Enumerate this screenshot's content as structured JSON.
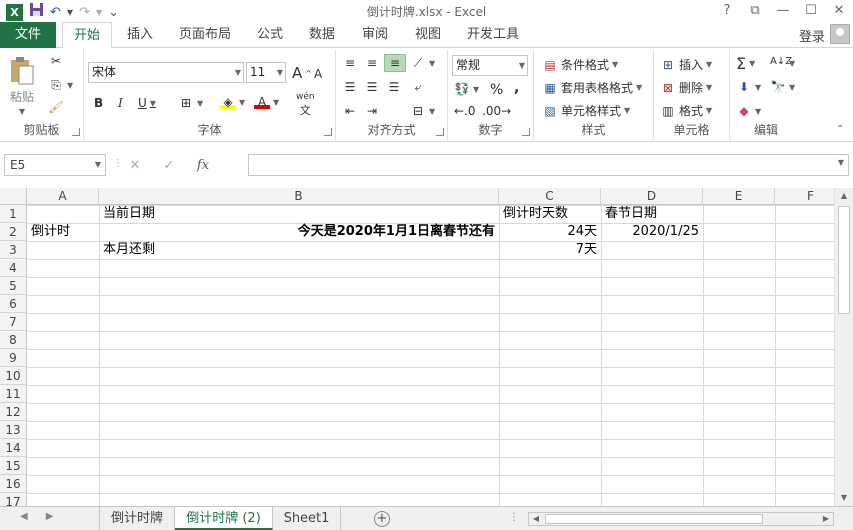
{
  "window": {
    "title": "倒计时牌.xlsx - Excel",
    "help": "?",
    "controls": [
      "⧉",
      "—",
      "☐",
      "✕"
    ]
  },
  "qat": {
    "logo": "X",
    "save": "💾",
    "undo": "↶",
    "redo": "↷",
    "customize": "⌄"
  },
  "tabs": {
    "file": "文件",
    "items": [
      "开始",
      "插入",
      "页面布局",
      "公式",
      "数据",
      "审阅",
      "视图",
      "开发工具"
    ],
    "active": "开始",
    "login": "登录"
  },
  "ribbon": {
    "clipboard": {
      "label": "剪贴板",
      "paste": "粘贴"
    },
    "font": {
      "label": "字体",
      "name": "宋体",
      "size": "11",
      "bold": "B",
      "italic": "I",
      "underline": "U",
      "grow": "A",
      "shrink": "A",
      "wen": "wén"
    },
    "alignment": {
      "label": "对齐方式"
    },
    "number": {
      "label": "数字",
      "format": "常规",
      "percent": "%",
      "comma": ","
    },
    "styles": {
      "label": "样式",
      "conditional": "条件格式",
      "table": "套用表格格式",
      "cell_styles": "单元格样式"
    },
    "cells": {
      "label": "单元格",
      "insert": "插入",
      "delete": "删除",
      "format": "格式"
    },
    "editing": {
      "label": "编辑"
    }
  },
  "formula_bar": {
    "name_box": "E5",
    "cancel": "✕",
    "enter": "✓",
    "fx": "fx",
    "value": ""
  },
  "grid": {
    "columns": [
      "A",
      "B",
      "C",
      "D",
      "E",
      "F"
    ],
    "rows": [
      "1",
      "2",
      "3",
      "4",
      "5",
      "6",
      "7",
      "8",
      "9",
      "10",
      "11",
      "12",
      "13",
      "14",
      "15",
      "16",
      "17"
    ],
    "cells": {
      "B1": "当前日期",
      "C1": "倒计时天数",
      "D1": "春节日期",
      "A2": "倒计时",
      "B2": "今天是2020年1月1日离春节还有",
      "C2": "24天",
      "D2": "2020/1/25",
      "B3": "本月还剩",
      "C3": "7天"
    }
  },
  "sheets": {
    "tabs": [
      "倒计时牌",
      "倒计时牌 (2)",
      "Sheet1"
    ],
    "active": "倒计时牌 (2)",
    "add": "+"
  }
}
